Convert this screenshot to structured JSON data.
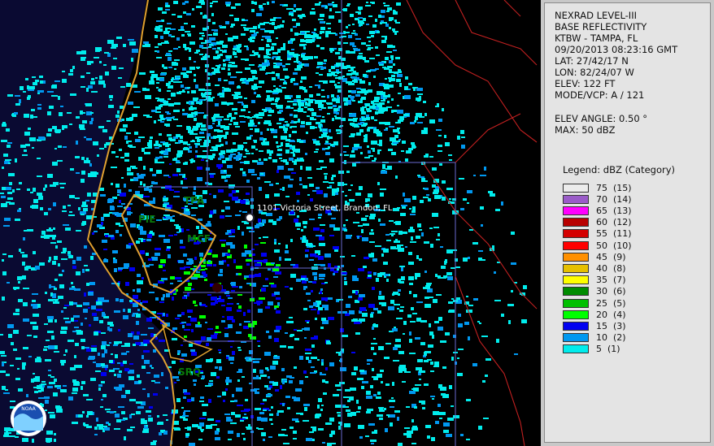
{
  "info": {
    "line1": "NEXRAD LEVEL-III",
    "line2": "BASE REFLECTIVITY",
    "station": "KTBW - TAMPA, FL",
    "datetime": "09/20/2013 08:23:16 GMT",
    "lat": "LAT: 27/42/17 N",
    "lon": "LON: 82/24/07 W",
    "elev": "ELEV: 122 FT",
    "mode": "MODE/VCP: A / 121",
    "elev_angle": "ELEV ANGLE: 0.50 °",
    "max": "MAX: 50 dBZ"
  },
  "legend": {
    "title": "Legend: dBZ (Category)",
    "items": [
      {
        "label": "75  (15)",
        "color": "#ececec"
      },
      {
        "label": "70  (14)",
        "color": "#9a5cc8"
      },
      {
        "label": "65  (13)",
        "color": "#ff00ff"
      },
      {
        "label": "60  (12)",
        "color": "#b80000"
      },
      {
        "label": "55  (11)",
        "color": "#d40000"
      },
      {
        "label": "50  (10)",
        "color": "#ff0000"
      },
      {
        "label": "45  (9)",
        "color": "#ff9000"
      },
      {
        "label": "40  (8)",
        "color": "#e6c000"
      },
      {
        "label": "35  (7)",
        "color": "#ffff00"
      },
      {
        "label": "30  (6)",
        "color": "#008c00"
      },
      {
        "label": "25  (5)",
        "color": "#00c000"
      },
      {
        "label": "20  (4)",
        "color": "#00ff00"
      },
      {
        "label": "15  (3)",
        "color": "#0000f0"
      },
      {
        "label": "10  (2)",
        "color": "#0098f0"
      },
      {
        "label": "5  (1)",
        "color": "#00ecec"
      }
    ]
  },
  "map": {
    "stations": [
      "TPA",
      "PIE",
      "MCF",
      "SRQ"
    ],
    "address": "1101 Victoria Street, Brandon, FL",
    "logo_text": "NOAA"
  }
}
